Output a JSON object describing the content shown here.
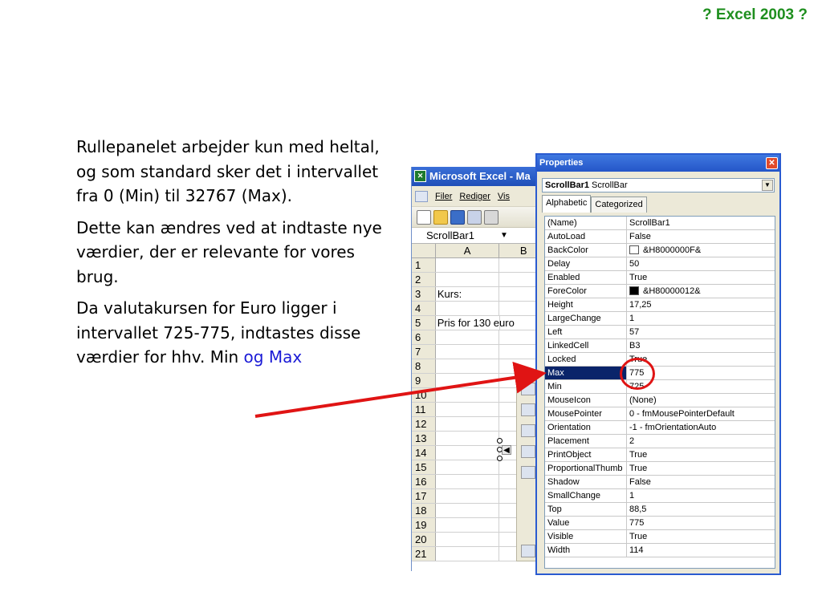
{
  "slide": {
    "title": "? Excel 2003 ?",
    "paragraphs": [
      "Rullepanelet arbejder kun med heltal, og som standard sker det i intervallet fra 0 (Min) til 32767 (Max).",
      "Dette kan ændres ved at indtaste nye værdier, der er relevante for vores brug.",
      "Da valutakursen for Euro ligger i intervallet 725-775, indtastes disse værdier for hhv. Min "
    ],
    "highlight": "og Max"
  },
  "excel": {
    "title": "Microsoft Excel - Ma",
    "menu": [
      "Filer",
      "Rediger",
      "Vis"
    ],
    "namebox": "ScrollBar1",
    "columns": [
      "A",
      "B"
    ],
    "rows": [
      {
        "num": "1",
        "a": ""
      },
      {
        "num": "2",
        "a": ""
      },
      {
        "num": "3",
        "a": "Kurs:"
      },
      {
        "num": "4",
        "a": ""
      },
      {
        "num": "5",
        "a": "Pris for 130 euro"
      },
      {
        "num": "6",
        "a": ""
      },
      {
        "num": "7",
        "a": ""
      },
      {
        "num": "8",
        "a": ""
      },
      {
        "num": "9",
        "a": ""
      },
      {
        "num": "10",
        "a": ""
      },
      {
        "num": "11",
        "a": ""
      },
      {
        "num": "12",
        "a": ""
      },
      {
        "num": "13",
        "a": ""
      },
      {
        "num": "14",
        "a": ""
      },
      {
        "num": "15",
        "a": ""
      },
      {
        "num": "16",
        "a": ""
      },
      {
        "num": "17",
        "a": ""
      },
      {
        "num": "18",
        "a": ""
      },
      {
        "num": "19",
        "a": ""
      },
      {
        "num": "20",
        "a": ""
      },
      {
        "num": "21",
        "a": ""
      }
    ]
  },
  "properties": {
    "title": "Properties",
    "object_name": "ScrollBar1",
    "object_type": "ScrollBar",
    "tabs": [
      "Alphabetic",
      "Categorized"
    ],
    "rows": [
      {
        "name": "(Name)",
        "value": "ScrollBar1"
      },
      {
        "name": "AutoLoad",
        "value": "False"
      },
      {
        "name": "BackColor",
        "value": "&H8000000F&",
        "swatch": "#ffffff"
      },
      {
        "name": "Delay",
        "value": "50"
      },
      {
        "name": "Enabled",
        "value": "True"
      },
      {
        "name": "ForeColor",
        "value": "&H80000012&",
        "swatch": "#000000"
      },
      {
        "name": "Height",
        "value": "17,25"
      },
      {
        "name": "LargeChange",
        "value": "1"
      },
      {
        "name": "Left",
        "value": "57"
      },
      {
        "name": "LinkedCell",
        "value": "B3"
      },
      {
        "name": "Locked",
        "value": "True"
      },
      {
        "name": "Max",
        "value": "775",
        "selected": true
      },
      {
        "name": "Min",
        "value": "725"
      },
      {
        "name": "MouseIcon",
        "value": "(None)"
      },
      {
        "name": "MousePointer",
        "value": "0 - fmMousePointerDefault"
      },
      {
        "name": "Orientation",
        "value": "-1 - fmOrientationAuto"
      },
      {
        "name": "Placement",
        "value": "2"
      },
      {
        "name": "PrintObject",
        "value": "True"
      },
      {
        "name": "ProportionalThumb",
        "value": "True"
      },
      {
        "name": "Shadow",
        "value": "False"
      },
      {
        "name": "SmallChange",
        "value": "1"
      },
      {
        "name": "Top",
        "value": "88,5"
      },
      {
        "name": "Value",
        "value": "775"
      },
      {
        "name": "Visible",
        "value": "True"
      },
      {
        "name": "Width",
        "value": "114"
      }
    ]
  },
  "colors": {
    "title_green": "#1f8f1f",
    "highlight_blue": "#1a1ad6",
    "annotation_red": "#e01414",
    "selection_navy": "#0a246a"
  }
}
